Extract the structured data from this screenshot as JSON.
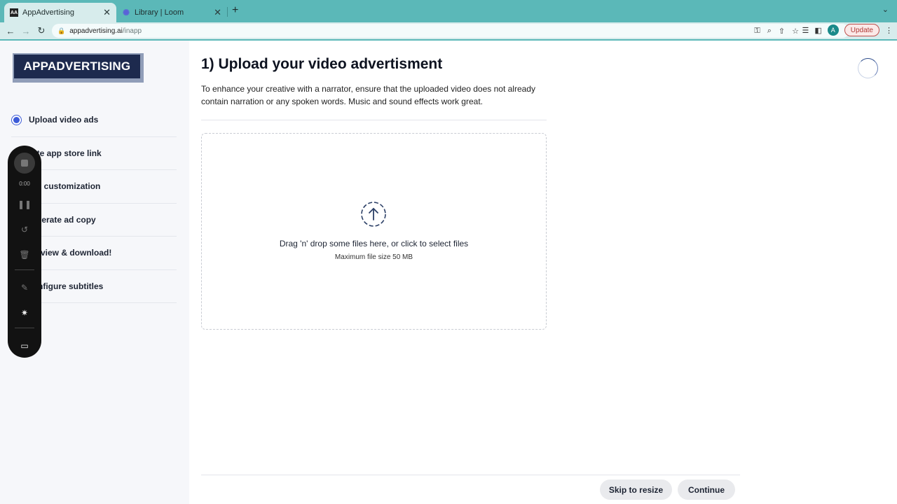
{
  "browser": {
    "tabs": [
      {
        "favicon": "AA",
        "title": "AppAdvertising",
        "active": true
      },
      {
        "favicon": "loom-icon",
        "title": "Library | Loom",
        "active": false
      }
    ],
    "url_host": "appadvertising.ai",
    "url_path": "/inapp",
    "profile_initial": "A",
    "update_label": "Update"
  },
  "sidebar": {
    "logo_text": "APPADVERTISING",
    "steps": [
      {
        "label": "Upload video ads",
        "selected": true
      },
      {
        "label": "ste app store link",
        "selected": false
      },
      {
        "label": "ce customization",
        "selected": false
      },
      {
        "label": "nerate ad copy",
        "selected": false
      },
      {
        "label": "view & download!",
        "selected": false
      },
      {
        "label": "nfigure subtitles",
        "selected": false
      }
    ]
  },
  "recorder": {
    "time": "0:00"
  },
  "main": {
    "title": "1) Upload your video advertisment",
    "description": "To enhance your creative with a narrator, ensure that the uploaded video does not already contain narration or any spoken words. Music and sound effects work great.",
    "dropzone": {
      "text": "Drag 'n' drop some files here, or click to select files",
      "subtext": "Maximum file size 50 MB"
    },
    "skip_label": "Skip to resize",
    "continue_label": "Continue"
  },
  "colors": {
    "chrome": "#5bb8b8",
    "logo_bg": "#1d2a4e",
    "accent": "#3c5bd8"
  }
}
